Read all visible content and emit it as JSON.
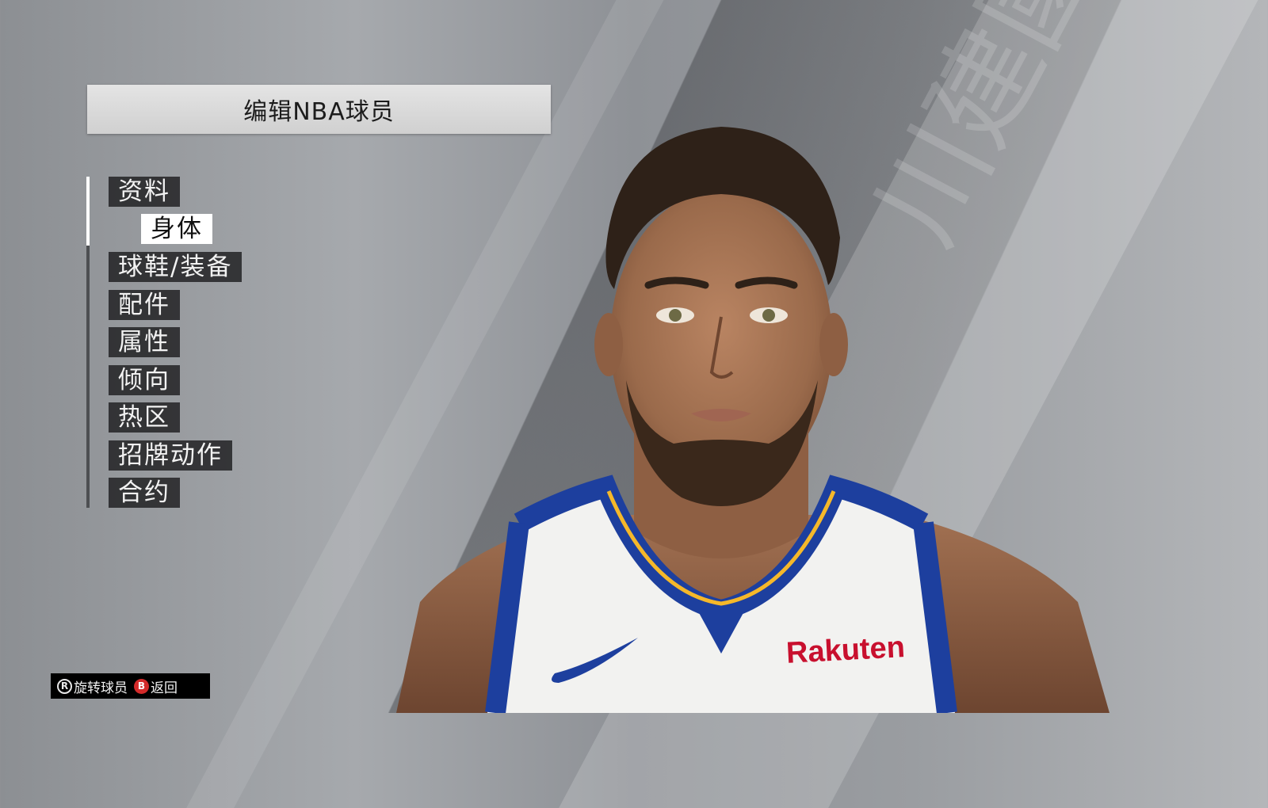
{
  "header": {
    "title": "编辑NBA球员"
  },
  "menu": {
    "items": [
      {
        "label": "资料",
        "active": false
      },
      {
        "label": "身体",
        "active": true
      },
      {
        "label": "球鞋/装备",
        "active": false
      },
      {
        "label": "配件",
        "active": false
      },
      {
        "label": "属性",
        "active": false
      },
      {
        "label": "倾向",
        "active": false
      },
      {
        "label": "热区",
        "active": false
      },
      {
        "label": "招牌动作",
        "active": false
      },
      {
        "label": "合约",
        "active": false
      }
    ]
  },
  "player": {
    "jersey_sponsor": "Rakuten",
    "jersey_colors": {
      "base": "#f2f2f0",
      "trim": "#1d3f9e",
      "accent": "#f5b82a",
      "sponsor": "#c8102e"
    }
  },
  "watermark": {
    "text": "川建國"
  },
  "footer": {
    "rotate_button_glyph": "R",
    "rotate_label": "旋转球员",
    "back_button_glyph": "B",
    "back_label": "返回"
  },
  "colors": {
    "menu_bg": "#262628",
    "menu_active_bg": "#ffffff",
    "back_button": "#d42a2a"
  }
}
